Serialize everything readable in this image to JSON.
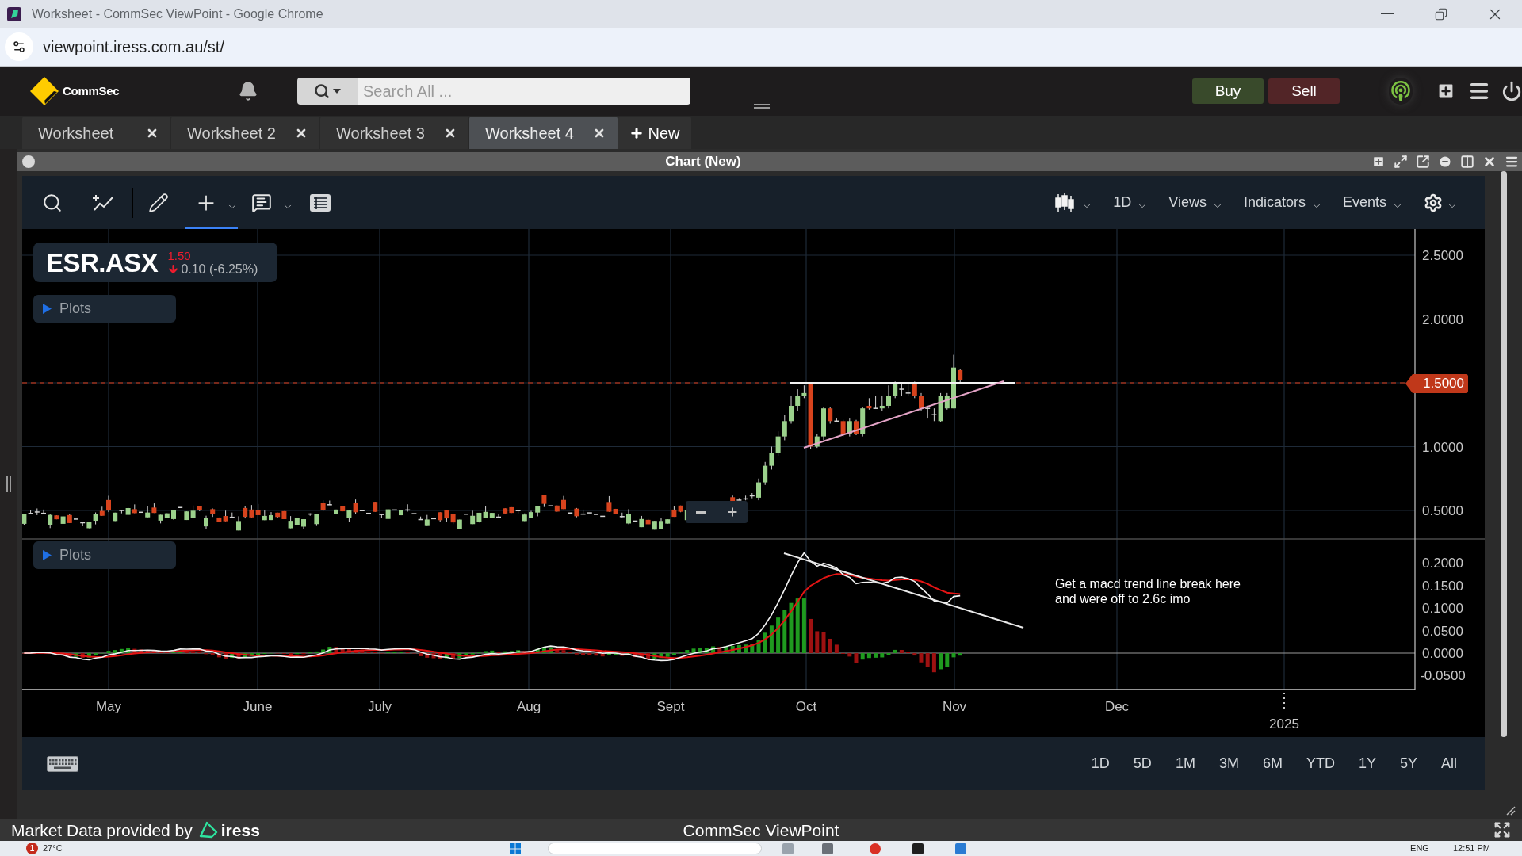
{
  "browser": {
    "title": "Worksheet - CommSec ViewPoint - Google Chrome",
    "url": "viewpoint.iress.com.au/st/"
  },
  "header": {
    "brand": "CommSec",
    "search": {
      "placeholder": "Search All ..."
    },
    "trade_buttons": [
      {
        "label": "Buy",
        "kind": "buy"
      },
      {
        "label": "Sell",
        "kind": "sell"
      }
    ]
  },
  "tabs": [
    {
      "label": "Worksheet",
      "selected": false
    },
    {
      "label": "Worksheet 2",
      "selected": false
    },
    {
      "label": "Worksheet 3",
      "selected": false
    },
    {
      "label": "Worksheet 4",
      "selected": true
    }
  ],
  "new_tab": {
    "label": "New"
  },
  "panel": {
    "title": "Chart (New)"
  },
  "toolbar": {
    "tools": [
      {
        "kind": "search",
        "selected": false,
        "menu": false
      },
      {
        "kind": "trend",
        "selected": false,
        "menu": false
      },
      {
        "kind": "pencil",
        "selected": false,
        "menu": false
      },
      {
        "kind": "crosshair",
        "selected": true,
        "menu": true
      },
      {
        "kind": "comment",
        "selected": false,
        "menu": true
      },
      {
        "kind": "table",
        "selected": false,
        "menu": false
      }
    ],
    "menus": [
      "1D",
      "Views",
      "Indicators",
      "Events"
    ]
  },
  "instrument": {
    "symbol": "ESR.ASX",
    "price": "1.50",
    "change": "0.10 (-6.25%)",
    "falling": true
  },
  "price_chart": {
    "plots_label": "Plots",
    "price_axis": [
      "2.5000",
      "2.0000",
      "1.0000",
      "0.5000"
    ],
    "last_price": "1.5000"
  },
  "macd_chart": {
    "plots_label": "Plots",
    "axis": [
      "0.2000",
      "0.1500",
      "0.1000",
      "0.0500",
      "0.0000",
      "-0.0500"
    ],
    "note": "Get a macd trend line break here\nand were off to 2.6c imo"
  },
  "date_axis": {
    "months": [
      "May",
      "June",
      "July",
      "Aug",
      "Sept",
      "Oct",
      "Nov",
      "Dec"
    ],
    "year": "2025"
  },
  "ranges": [
    "1D",
    "5D",
    "1M",
    "3M",
    "6M",
    "YTD",
    "1Y",
    "5Y",
    "All"
  ],
  "footer": {
    "credit": "Market Data provided by",
    "provider": "iress",
    "title": "CommSec ViewPoint"
  },
  "taskbar": {
    "alerts": "1",
    "weather": "27°C",
    "language": "ENG",
    "time": "12:51 PM"
  }
}
